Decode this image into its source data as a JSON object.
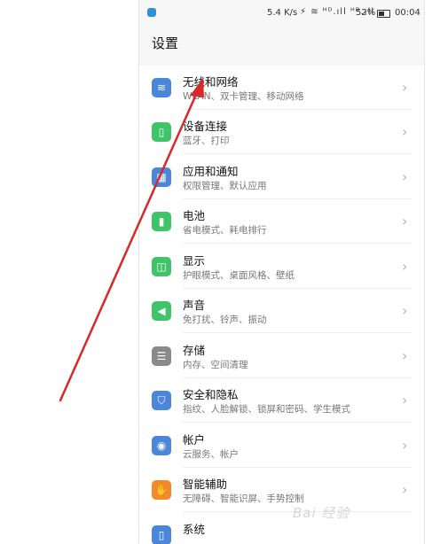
{
  "status": {
    "speed": "5.4 K/s",
    "signal_glyphs": "⚡ ≋ ᴴᴰ.ıll ᴴᴰ.ıll",
    "battery": "52%",
    "time": "00:04"
  },
  "page": {
    "title": "设置"
  },
  "items": [
    {
      "label": "无线和网络",
      "sub": "WLAN、双卡管理、移动网络",
      "icon": "wifi-icon",
      "glyph": "≋",
      "color": "#4a86d9"
    },
    {
      "label": "设备连接",
      "sub": "蓝牙、打印",
      "icon": "device-connect-icon",
      "glyph": "▯",
      "color": "#3fc46a"
    },
    {
      "label": "应用和通知",
      "sub": "权限管理、默认应用",
      "icon": "apps-icon",
      "glyph": "▦",
      "color": "#4a86d9"
    },
    {
      "label": "电池",
      "sub": "省电模式、耗电排行",
      "icon": "battery-icon",
      "glyph": "▮",
      "color": "#3fc46a"
    },
    {
      "label": "显示",
      "sub": "护眼模式、桌面风格、壁纸",
      "icon": "display-icon",
      "glyph": "◫",
      "color": "#3fc46a"
    },
    {
      "label": "声音",
      "sub": "免打扰、铃声、振动",
      "icon": "sound-icon",
      "glyph": "◀",
      "color": "#3fc46a"
    },
    {
      "label": "存储",
      "sub": "内存、空间清理",
      "icon": "storage-icon",
      "glyph": "☰",
      "color": "#8a8a8a"
    },
    {
      "label": "安全和隐私",
      "sub": "指纹、人脸解锁、锁屏和密码、学生模式",
      "icon": "shield-icon",
      "glyph": "⛉",
      "color": "#4a86d9"
    },
    {
      "label": "帐户",
      "sub": "云服务、帐户",
      "icon": "account-icon",
      "glyph": "◉",
      "color": "#4a86d9"
    },
    {
      "label": "智能辅助",
      "sub": "无障碍、智能识屏、手势控制",
      "icon": "hand-icon",
      "glyph": "✋",
      "color": "#f08a2a"
    },
    {
      "label": "系统",
      "sub": "",
      "icon": "system-icon",
      "glyph": "▯",
      "color": "#4a86d9"
    }
  ],
  "watermark": "Bai 经验"
}
